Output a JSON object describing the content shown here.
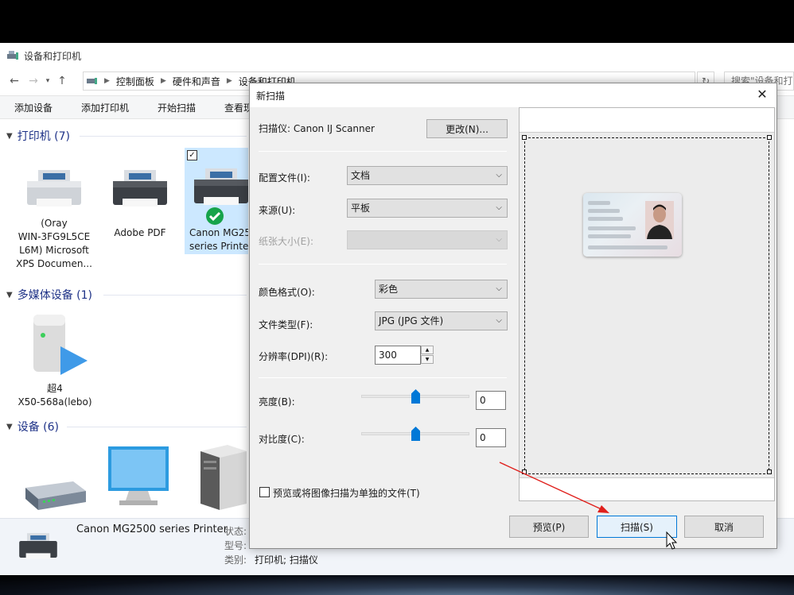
{
  "explorer": {
    "title": "设备和打印机",
    "address": [
      "控制面板",
      "硬件和声音",
      "设备和打印机"
    ],
    "search_placeholder": "搜索\"设备和打印机\"",
    "commands": [
      "添加设备",
      "添加打印机",
      "开始扫描",
      "查看现在"
    ],
    "sections": {
      "printers": {
        "title": "打印机 (7)",
        "items": [
          {
            "label": "(Oray\nWIN-3FG9L5CE\nL6M) Microsoft\nXPS Documen..."
          },
          {
            "label": "Adobe PDF"
          },
          {
            "label": "Canon MG25\nseries Printe"
          }
        ]
      },
      "multimedia": {
        "title": "多媒体设备 (1)",
        "items": [
          {
            "label": "超4\nX50-568a(lebo)"
          }
        ]
      },
      "devices": {
        "title": "设备 (6)"
      }
    },
    "details": {
      "name": "Canon MG2500 series Printer",
      "status_label": "状态:",
      "model_label": "型号:",
      "category_label": "类别:",
      "category_value": "打印机; 扫描仪"
    }
  },
  "scan_dialog": {
    "title": "新扫描",
    "scanner_label": "扫描仪: Canon IJ Scanner",
    "change_button": "更改(N)...",
    "profile_label": "配置文件(I):",
    "profile_value": "文档",
    "source_label": "来源(U):",
    "source_value": "平板",
    "paper_size_label": "纸张大小(E):",
    "paper_size_value": "",
    "color_format_label": "颜色格式(O):",
    "color_format_value": "彩色",
    "file_type_label": "文件类型(F):",
    "file_type_value": "JPG (JPG 文件)",
    "resolution_label": "分辨率(DPI)(R):",
    "resolution_value": "300",
    "brightness_label": "亮度(B):",
    "brightness_value": "0",
    "contrast_label": "对比度(C):",
    "contrast_value": "0",
    "separate_files_label": "预览或将图像扫描为单独的文件(T)",
    "preview_button": "预览(P)",
    "scan_button": "扫描(S)",
    "cancel_button": "取消"
  },
  "colors": {
    "accent": "#0078d7",
    "section_title": "#1e3287",
    "annotation_arrow": "#e0201c"
  }
}
